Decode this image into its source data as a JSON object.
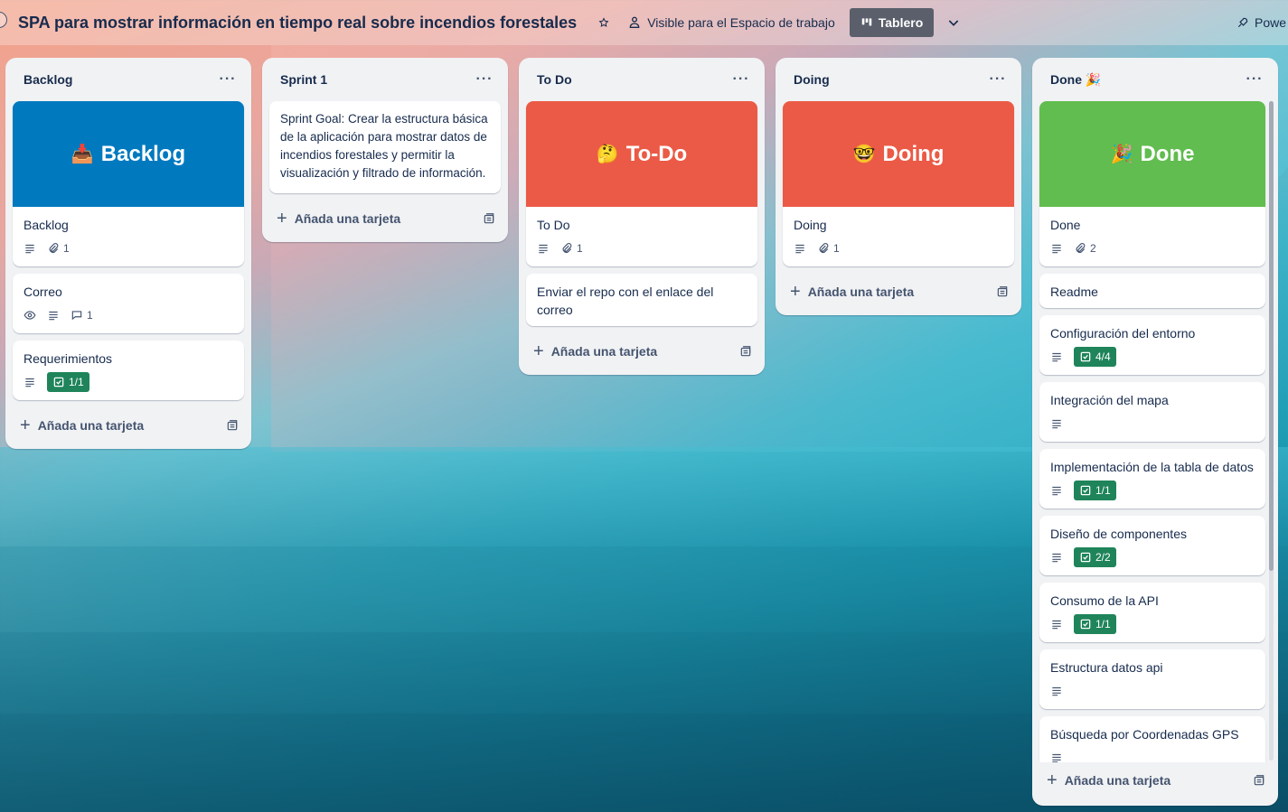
{
  "header": {
    "title": "SPA para mostrar información en tiempo real sobre incendios forestales",
    "visibility": "Visible para el Espacio de trabajo",
    "view": "Tablero",
    "power": "Powe"
  },
  "add_card_label": "Añada una tarjeta",
  "colors": {
    "backlog_cover": "#0079bf",
    "todo_cover": "#eb5a46",
    "doing_cover": "#eb5a46",
    "done_cover": "#61bd4f",
    "checklist_badge": "#1f845a"
  },
  "lists": [
    {
      "title": "Backlog",
      "cards": [
        {
          "cover_title": "Backlog",
          "cover_emoji": "📥",
          "title": "Backlog",
          "attachments": "1"
        },
        {
          "title": "Correo",
          "comments": "1"
        },
        {
          "title": "Requerimientos",
          "checklist": "1/1"
        }
      ]
    },
    {
      "title": "Sprint 1",
      "cards": [
        {
          "title": "Sprint Goal: Crear la estructura básica de la aplicación para mostrar datos de incendios forestales y permitir la visualización y filtrado de información."
        }
      ]
    },
    {
      "title": "To Do",
      "cards": [
        {
          "cover_title": "To-Do",
          "cover_emoji": "🤔",
          "title": "To Do",
          "attachments": "1"
        },
        {
          "title": "Enviar el repo con el enlace del correo"
        }
      ]
    },
    {
      "title": "Doing",
      "cards": [
        {
          "cover_title": "Doing",
          "cover_emoji": "🤓",
          "title": "Doing",
          "attachments": "1"
        }
      ]
    },
    {
      "title": "Done 🎉",
      "cards": [
        {
          "cover_title": "Done",
          "cover_emoji": "🎉",
          "title": "Done",
          "attachments": "2"
        },
        {
          "title": "Readme"
        },
        {
          "title": "Configuración del entorno",
          "checklist": "4/4"
        },
        {
          "title": "Integración del mapa"
        },
        {
          "title": "Implementación de la tabla de datos",
          "checklist": "1/1"
        },
        {
          "title": "Diseño de componentes",
          "checklist": "2/2"
        },
        {
          "title": "Consumo de la API",
          "checklist": "1/1"
        },
        {
          "title": "Estructura datos api"
        },
        {
          "title": "Búsqueda por Coordenadas GPS"
        }
      ]
    }
  ]
}
